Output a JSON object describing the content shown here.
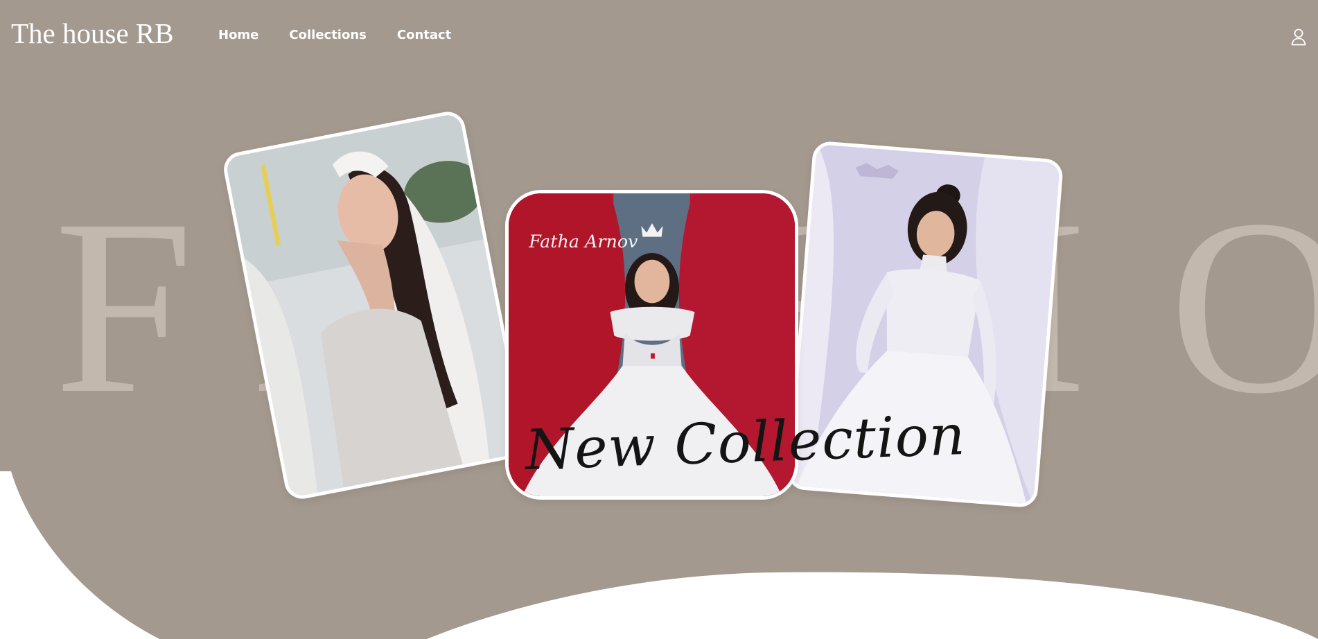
{
  "header": {
    "logo": "The house RB",
    "nav": [
      {
        "label": "Home"
      },
      {
        "label": "Collections"
      },
      {
        "label": "Contact"
      }
    ],
    "account_icon": "user-icon"
  },
  "hero": {
    "background_word": "FASHION",
    "script_text": "New Collection",
    "images": [
      {
        "description": "bride with crystal tiara and lace veil",
        "icon": "photo-icon"
      },
      {
        "description": "bride in off-shoulder ball gown before red curtains",
        "icon": "photo-icon"
      },
      {
        "description": "bride in long-sleeve sequin ball gown",
        "icon": "photo-icon"
      }
    ]
  },
  "colors": {
    "taupe": "#a3998e",
    "word": "#c3b8ae",
    "white": "#ffffff",
    "script": "#141414"
  }
}
